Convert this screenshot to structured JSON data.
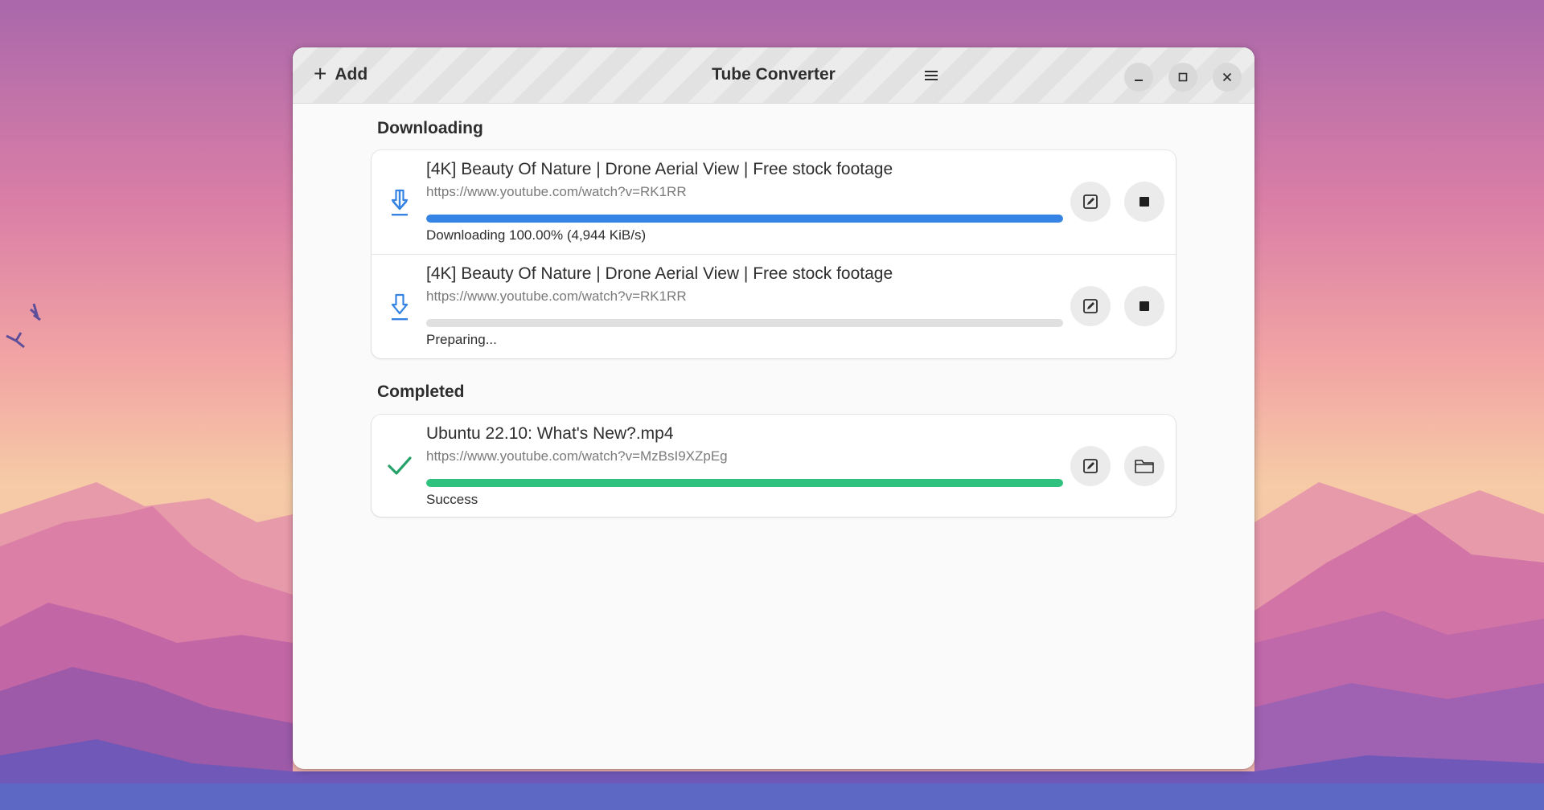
{
  "app": {
    "title": "Tube Converter",
    "add_label": "Add"
  },
  "window_controls": {
    "menu_icon": "hamburger-menu-icon",
    "minimize_icon": "minimize-icon",
    "maximize_icon": "maximize-icon",
    "close_icon": "close-icon"
  },
  "sections": {
    "downloading": {
      "title": "Downloading",
      "items": [
        {
          "title": "[4K] Beauty Of Nature | Drone Aerial View | Free stock footage",
          "url": "https://www.youtube.com/watch?v=RK1RR",
          "status": "Downloading 100.00% (4,944 KiB/s)",
          "progress": 1.0,
          "icon": "download-arrow-icon",
          "actions": [
            "edit-icon",
            "stop-icon"
          ]
        },
        {
          "title": "[4K] Beauty Of Nature | Drone Aerial View | Free stock footage",
          "url": "https://www.youtube.com/watch?v=RK1RR",
          "status": "Preparing...",
          "progress": 0.0,
          "icon": "download-arrow-icon",
          "actions": [
            "edit-icon",
            "stop-icon"
          ]
        }
      ]
    },
    "completed": {
      "title": "Completed",
      "items": [
        {
          "title": "Ubuntu 22.10: What's New?.mp4",
          "url": "https://www.youtube.com/watch?v=MzBsI9XZpEg",
          "status": "Success",
          "progress": 1.0,
          "icon": "checkmark-icon",
          "actions": [
            "edit-icon",
            "folder-icon"
          ]
        }
      ]
    }
  },
  "colors": {
    "accent_blue": "#3584e4",
    "success_green": "#2ec27e",
    "track_gray": "#e0e0e0"
  }
}
